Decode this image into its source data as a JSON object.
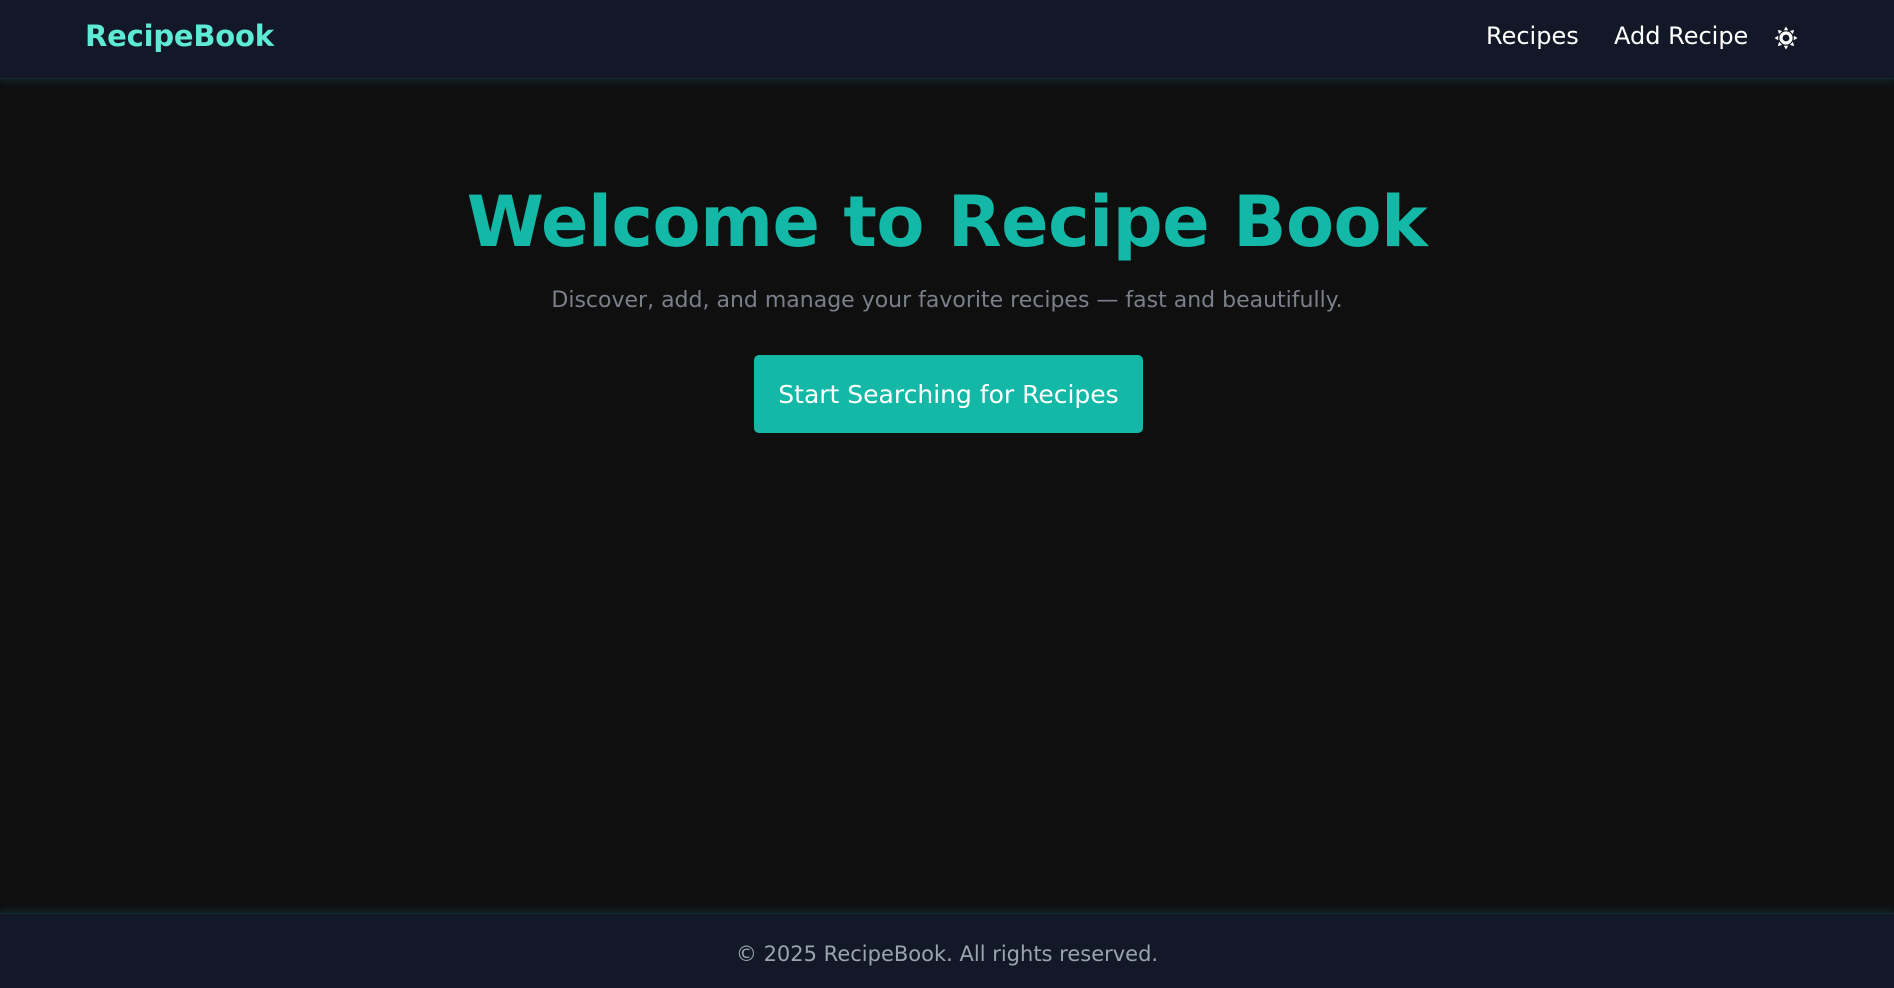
{
  "header": {
    "brand": "RecipeBook",
    "nav": {
      "recipes_label": "Recipes",
      "add_recipe_label": "Add Recipe"
    },
    "theme_toggle_icon": "sun-icon"
  },
  "hero": {
    "title": "Welcome to Recipe Book",
    "subtitle": "Discover, add, and manage your favorite recipes — fast and beautifully.",
    "cta_label": "Start Searching for Recipes"
  },
  "footer": {
    "text": "© 2025 RecipeBook. All rights reserved."
  },
  "colors": {
    "background": "#0f0f10",
    "navbar_bg": "#121828",
    "accent": "#14b8a6",
    "brand": "#5eead4",
    "subtitle": "#7b7f8a",
    "footer_text": "#9ca3af"
  }
}
